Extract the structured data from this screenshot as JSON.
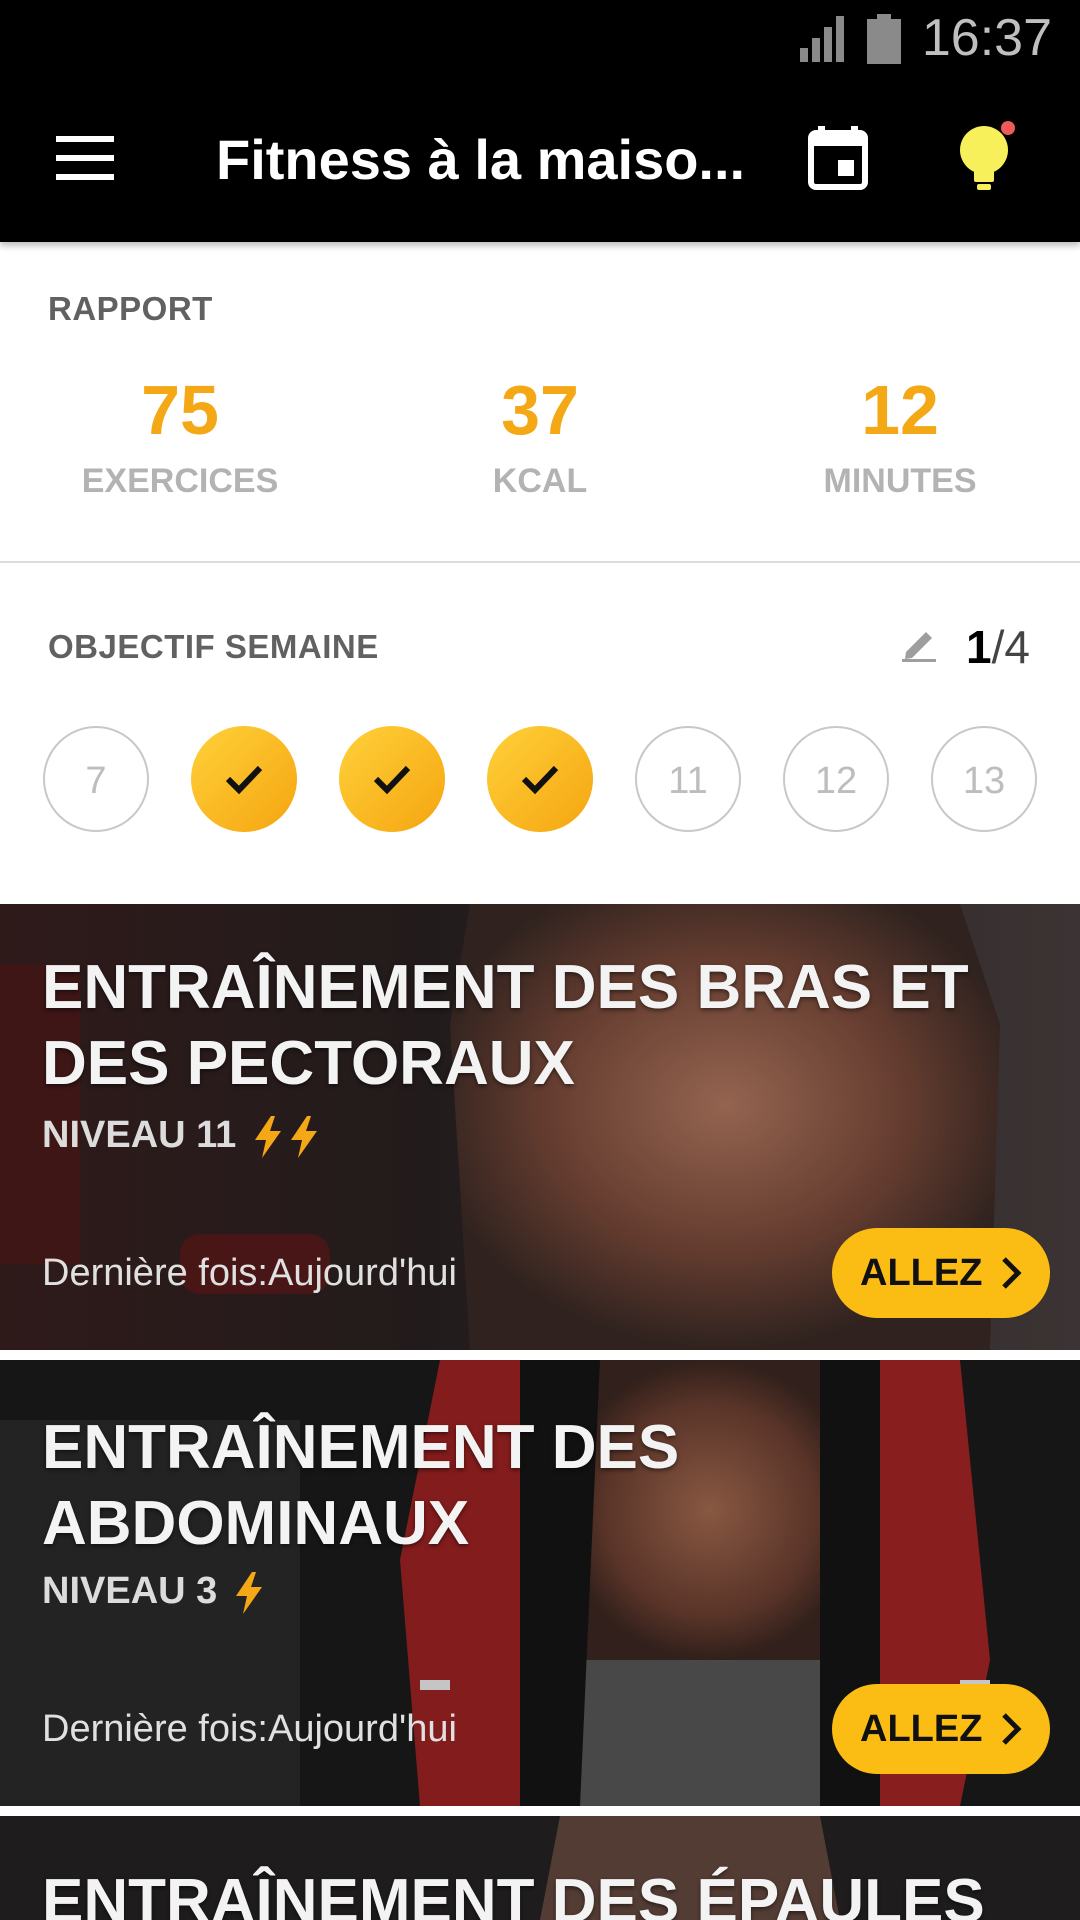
{
  "status_bar": {
    "time": "16:37"
  },
  "toolbar": {
    "title": "Fitness à la maiso..."
  },
  "report": {
    "title": "RAPPORT",
    "stats": [
      {
        "value": "75",
        "label": "EXERCICES"
      },
      {
        "value": "37",
        "label": "KCAL"
      },
      {
        "value": "12",
        "label": "MINUTES"
      }
    ]
  },
  "weekly_goal": {
    "title": "OBJECTIF SEMAINE",
    "done": "1",
    "separator_total": "/4",
    "days": [
      {
        "label": "7",
        "completed": false
      },
      {
        "label": "",
        "completed": true
      },
      {
        "label": "",
        "completed": true
      },
      {
        "label": "",
        "completed": true
      },
      {
        "label": "11",
        "completed": false
      },
      {
        "label": "12",
        "completed": false
      },
      {
        "label": "13",
        "completed": false
      }
    ]
  },
  "workouts": [
    {
      "title": "ENTRAÎNEMENT DES BRAS ET DES PECTORAUX",
      "level": "NIVEAU 11",
      "bolts": 2,
      "last_time": "Dernière fois:Aujourd'hui",
      "button": "ALLEZ"
    },
    {
      "title": "ENTRAÎNEMENT DES ABDOMINAUX",
      "level": "NIVEAU 3",
      "bolts": 1,
      "last_time": "Dernière fois:Aujourd'hui",
      "button": "ALLEZ"
    },
    {
      "title": "ENTRAÎNEMENT DES ÉPAULES"
    }
  ],
  "colors": {
    "accent": "#f5a815",
    "button": "#fbbd14",
    "bar": "#000000"
  }
}
